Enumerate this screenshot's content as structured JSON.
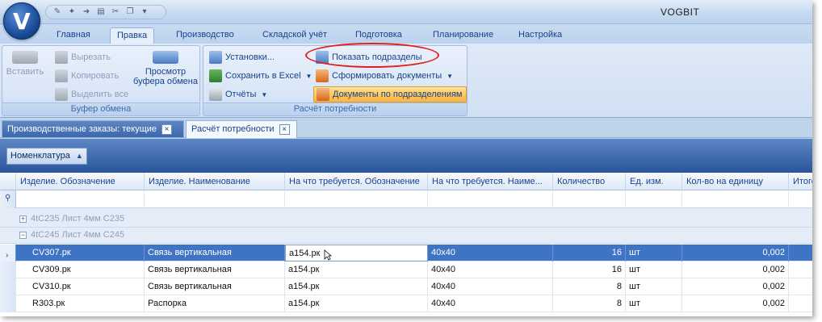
{
  "app": {
    "title": "VOGBIT",
    "logo_glyph": "V"
  },
  "qat": {
    "icons": [
      "tools-icon",
      "wand-icon",
      "exit-icon",
      "clipboard-icon",
      "scissors-icon",
      "copy-icon"
    ]
  },
  "ribbon_tabs": [
    "Главная",
    "Правка",
    "Производство",
    "Складской учёт",
    "Подготовка",
    "Планирование",
    "Настройка"
  ],
  "active_tab": "Правка",
  "clipboard_group": {
    "caption": "Буфер обмена",
    "paste": "Вставить",
    "cut": "Вырезать",
    "copy": "Копировать",
    "select_all": "Выделить все",
    "preview_line1": "Просмотр",
    "preview_line2": "буфера обмена"
  },
  "needs_group": {
    "caption": "Расчёт потребности",
    "settings": "Установки...",
    "save_excel": "Сохранить в Excel",
    "reports": "Отчёты",
    "show_subdivisions": "Показать подразделы",
    "form_documents": "Сформировать документы",
    "docs_by_subdivision": "Документы по подразделениям"
  },
  "doc_tabs": [
    {
      "label": "Производственные заказы: текущие",
      "close": "×"
    },
    {
      "label": "Расчёт потребности",
      "close": "×"
    }
  ],
  "grouping": {
    "chip": "Номенклатура",
    "arrow": "▲"
  },
  "grid": {
    "columns": [
      "Изделие. Обозначение",
      "Изделие. Наименование",
      "На что требуется. Обозначение",
      "На что требуется. Наиме...",
      "Количество",
      "Ед. изм.",
      "Кол-во на единицу",
      "Итого"
    ],
    "groups": [
      {
        "label": "4tC235 Лист 4мм С235",
        "expander": "+"
      },
      {
        "label": "4tC245 Лист 4мм С245",
        "expander": "−"
      }
    ],
    "rows": [
      {
        "designation": "CV307.рк",
        "name": "Связь вертикальная",
        "target": "a154.рк",
        "target_name": "40x40",
        "qty": "16",
        "unit": "шт",
        "per_unit": "0,002"
      },
      {
        "designation": "CV309.рк",
        "name": "Связь вертикальная",
        "target": "a154.рк",
        "target_name": "40x40",
        "qty": "16",
        "unit": "шт",
        "per_unit": "0,002"
      },
      {
        "designation": "CV310.рк",
        "name": "Связь вертикальная",
        "target": "a154.рк",
        "target_name": "40x40",
        "qty": "8",
        "unit": "шт",
        "per_unit": "0,002"
      },
      {
        "designation": "R303.рк",
        "name": "Распорка",
        "target": "a154.рк",
        "target_name": "40x40",
        "qty": "8",
        "unit": "шт",
        "per_unit": "0,002"
      }
    ],
    "selected_row_marker": "›"
  }
}
